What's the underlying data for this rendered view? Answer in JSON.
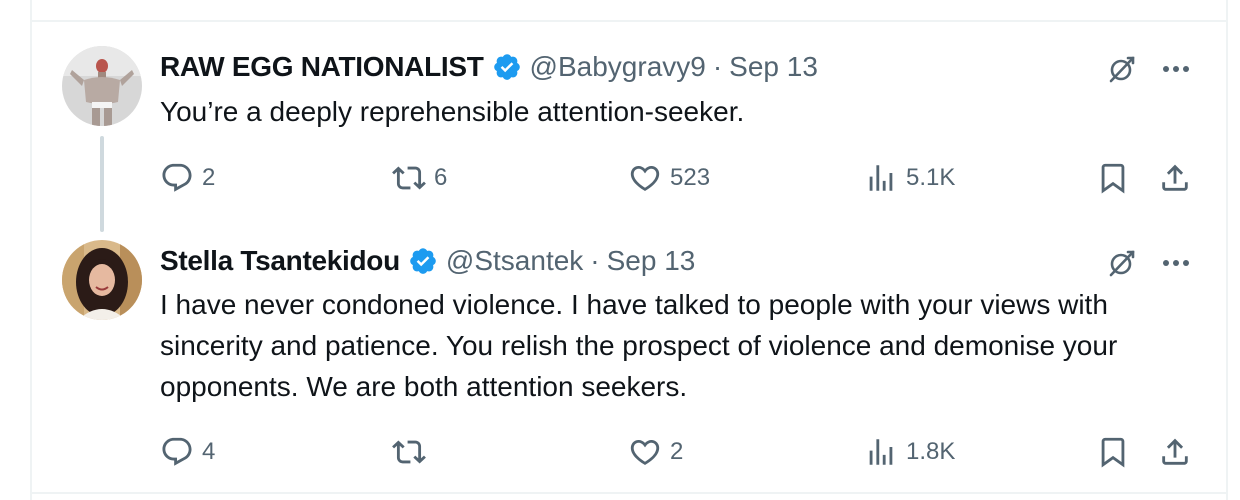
{
  "tweets": [
    {
      "author_name": "RAW EGG NATIONALIST",
      "handle": "@Babygravy9",
      "separator": "·",
      "date": "Sep 13",
      "text": "You’re a deeply reprehensible attention-seeker.",
      "replies": "2",
      "reposts": "6",
      "likes": "523",
      "views": "5.1K"
    },
    {
      "author_name": "Stella Tsantekidou",
      "handle": "@Stsantek",
      "separator": "·",
      "date": "Sep 13",
      "text": "I have never condoned violence. I have talked to people with your views with sincerity and patience. You relish the prospect of violence and demonise your opponents. We are both attention seekers.",
      "replies": "4",
      "reposts": "",
      "likes": "2",
      "views": "1.8K"
    }
  ],
  "colors": {
    "text": "#0f1419",
    "secondary": "#536471",
    "verified": "#1d9bf0",
    "thread_line": "#cfd9de"
  },
  "icons": [
    "verified-badge-icon",
    "grok-icon",
    "more-icon",
    "reply-icon",
    "repost-icon",
    "like-icon",
    "views-icon",
    "bookmark-icon",
    "share-icon"
  ]
}
